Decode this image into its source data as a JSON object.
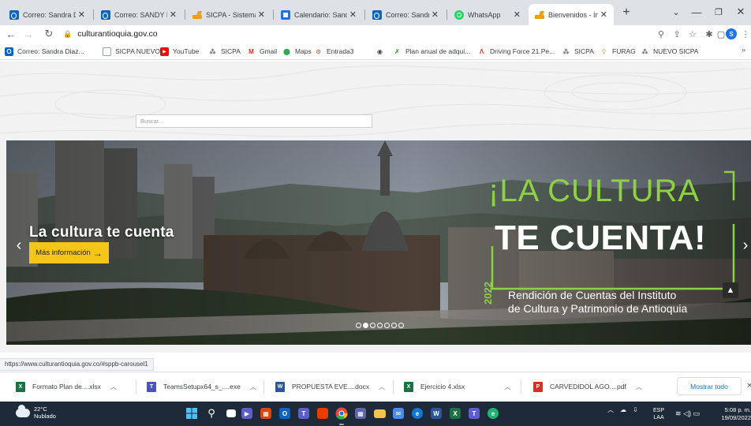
{
  "browser": {
    "tabs": [
      {
        "title": "Correo: Sandra D",
        "favicon": "outlook-icon"
      },
      {
        "title": "Correo: SANDY D",
        "favicon": "outlook-icon"
      },
      {
        "title": "SICPA - Sistema",
        "favicon": "sicpa-icon"
      },
      {
        "title": "Calendario: Sand",
        "favicon": "calendar-icon"
      },
      {
        "title": "Correo: Sandra D",
        "favicon": "outlook-icon"
      },
      {
        "title": "WhatsApp",
        "favicon": "whatsapp-icon"
      },
      {
        "title": "Bienvenidos - Ins",
        "favicon": "sicpa-icon",
        "active": true
      }
    ],
    "url": "culturantioquia.gov.co",
    "profile_initial": "S",
    "bookmarks": [
      {
        "label": "Correo: Sandra Diaz...",
        "icon": "outlook-icon"
      },
      {
        "label": "SICPA NUEVO",
        "icon": "cube-icon"
      },
      {
        "label": "YouTube",
        "icon": "youtube-icon"
      },
      {
        "label": "SICPA",
        "icon": "people-icon"
      },
      {
        "label": "Gmail",
        "icon": "gmail-icon"
      },
      {
        "label": "Maps",
        "icon": "maps-icon"
      },
      {
        "label": "Entrada3",
        "icon": "entrada-icon"
      },
      {
        "label": "",
        "icon": "globe-icon"
      },
      {
        "label": "Plan anual de adqui...",
        "icon": "plan-icon"
      },
      {
        "label": "Driving Force 21.Pe...",
        "icon": "driving-icon"
      },
      {
        "label": "SICPA",
        "icon": "people-icon"
      },
      {
        "label": "FURAG",
        "icon": "search-icon"
      },
      {
        "label": "NUEVO SICPA",
        "icon": "people-icon"
      }
    ],
    "bookmarks_more": "»",
    "status_url": "https://www.culturantioquia.gov.co/#sppb-carousel1"
  },
  "page": {
    "search_placeholder": "Buscar...",
    "hero": {
      "caption": "La cultura te cuenta",
      "button_label": "Más información",
      "headline_top": "¡LA CULTURA",
      "headline_bottom": "TE CUENTA!",
      "year": "2022",
      "subtitle_line1": "Rendición de Cuentas del Instituto",
      "subtitle_line2": "de Cultura y Patrimonio de Antioquia",
      "slides": 7,
      "active_slide": 1
    },
    "colors": {
      "accent_green": "#8ed146",
      "button_yellow": "#f5c518"
    }
  },
  "downloads": {
    "items": [
      {
        "name": "Formato Plan de....xlsx",
        "type": "excel"
      },
      {
        "name": "TeamsSetupx64_s_....exe",
        "type": "exe"
      },
      {
        "name": "PROPUESTA EVE....docx",
        "type": "word"
      },
      {
        "name": "Ejercicio 4.xlsx",
        "type": "excel"
      },
      {
        "name": "CARVEDIDOL AGO....pdf",
        "type": "pdf"
      }
    ],
    "show_all": "Mostrar todo"
  },
  "taskbar": {
    "weather_temp": "22°C",
    "weather_desc": "Nublado",
    "lang_top": "ESP",
    "lang_bottom": "LAA",
    "time": "5:08 p. m.",
    "date": "19/09/2022"
  }
}
